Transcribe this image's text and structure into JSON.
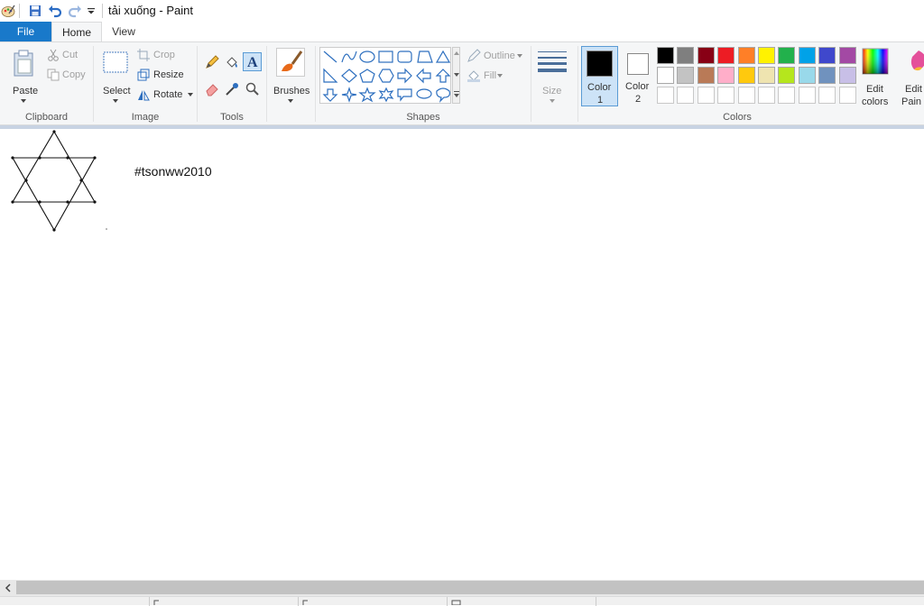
{
  "window": {
    "title": "tải xuống - Paint"
  },
  "quick_access": [
    {
      "icon": "save-icon"
    },
    {
      "icon": "undo-icon"
    },
    {
      "icon": "redo-icon"
    },
    {
      "icon": "customize-dropdown-icon"
    }
  ],
  "tabs": [
    {
      "label": "File"
    },
    {
      "label": "Home"
    },
    {
      "label": "View"
    }
  ],
  "clipboard": {
    "paste": "Paste",
    "cut": "Cut",
    "copy": "Copy",
    "group": "Clipboard"
  },
  "image": {
    "select": "Select",
    "crop": "Crop",
    "resize": "Resize",
    "rotate": "Rotate",
    "group": "Image"
  },
  "tools": {
    "group": "Tools"
  },
  "brushes": {
    "label": "Brushes"
  },
  "shapes": {
    "outline": "Outline",
    "fill": "Fill",
    "group": "Shapes"
  },
  "size": {
    "label": "Size"
  },
  "colors": {
    "color1": "Color",
    "color1_num": "1",
    "color2": "Color",
    "color2_num": "2",
    "edit_colors_1": "Edit",
    "edit_colors_2": "colors",
    "edit_paint_1": "Edit",
    "edit_paint_2": "Pain",
    "group": "Colors",
    "primary": "#000000",
    "secondary": "#ffffff",
    "palette_row1": [
      "#000000",
      "#7f7f7f",
      "#880015",
      "#ed1c24",
      "#ff7f27",
      "#fff200",
      "#22b14c",
      "#00a2e8",
      "#3f48cc",
      "#a349a4"
    ],
    "palette_row2": [
      "#ffffff",
      "#c3c3c3",
      "#b97a57",
      "#ffaec9",
      "#ffc90e",
      "#efe4b0",
      "#b5e61d",
      "#99d9ea",
      "#7092be",
      "#c8bfe7"
    ],
    "palette_row3": [
      "#ffffff",
      "#ffffff",
      "#ffffff",
      "#ffffff",
      "#ffffff",
      "#ffffff",
      "#ffffff",
      "#ffffff",
      "#ffffff",
      "#ffffff"
    ]
  },
  "canvas": {
    "text": "#tsonww2010"
  }
}
